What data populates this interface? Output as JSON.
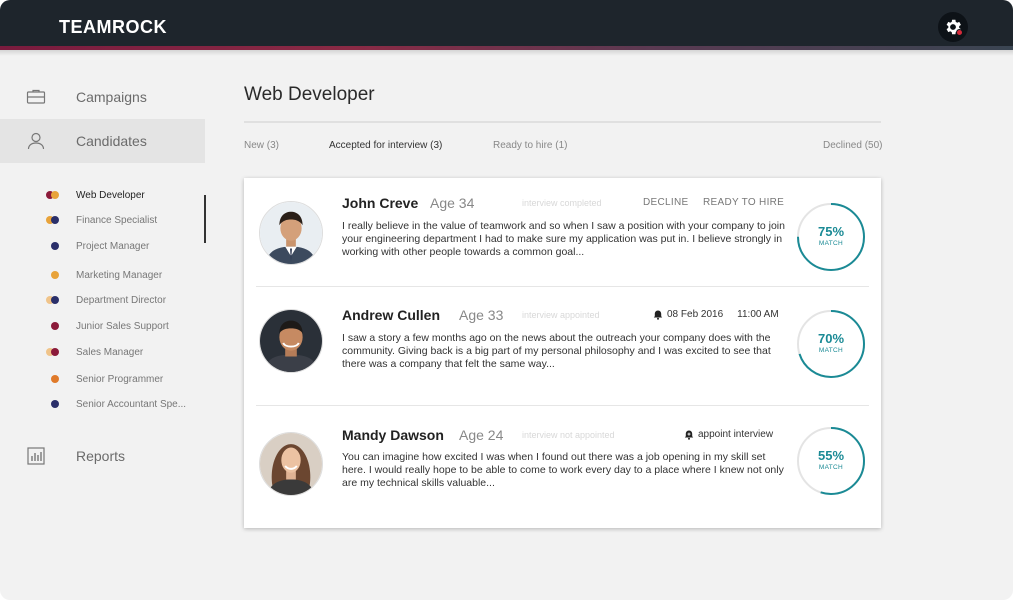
{
  "brand": {
    "logo_text": "TEAMROCK",
    "accent_colors": [
      "#7a1b3e",
      "#3a4552"
    ],
    "match_color": "#1a8a95"
  },
  "header": {
    "settings_icon": "gear-icon",
    "notification_color": "#d62a3a"
  },
  "sidebar": {
    "items": [
      {
        "label": "Campaigns",
        "icon": "briefcase-icon"
      },
      {
        "label": "Candidates",
        "icon": "user-icon"
      },
      {
        "label": "Reports",
        "icon": "bar-chart-icon"
      }
    ],
    "positions": [
      {
        "label": "Web Developer",
        "colors": [
          "#8b1a3a",
          "#e8a33a"
        ]
      },
      {
        "label": "Finance Specialist",
        "colors": [
          "#e8a33a",
          "#2a2f6a"
        ]
      },
      {
        "label": "Project Manager",
        "colors": [
          "#2a2f6a"
        ]
      },
      {
        "label": "Marketing Manager",
        "colors": [
          "#e8a33a"
        ]
      },
      {
        "label": "Department Director",
        "colors": [
          "#f0c48a",
          "#2a2f6a"
        ]
      },
      {
        "label": "Junior Sales Support",
        "colors": [
          "#8b1a3a"
        ]
      },
      {
        "label": "Sales Manager",
        "colors": [
          "#f0c48a",
          "#8b1a3a"
        ]
      },
      {
        "label": "Senior Programmer",
        "colors": [
          "#e07a2a"
        ]
      },
      {
        "label": "Senior Accountant Spe...",
        "colors": [
          "#2a2f6a"
        ]
      }
    ]
  },
  "main": {
    "title": "Web Developer",
    "tabs": [
      {
        "label": "New (3)"
      },
      {
        "label": "Accepted for interview (3)"
      },
      {
        "label": "Ready to hire (1)"
      },
      {
        "label": "Declined (50)"
      }
    ],
    "candidates": [
      {
        "name": "John Creve",
        "age": "Age 34",
        "status": "interview completed",
        "actions": [
          "DECLINE",
          "READY TO HIRE"
        ],
        "text": "I really believe in the value of teamwork and so when I saw a position with your company to join your engineering department I had to make sure my application was put in.  I believe strongly in working with other people towards a common goal...",
        "match_pct": "75%",
        "match_value": 75,
        "match_label": "MATCH"
      },
      {
        "name": "Andrew Cullen",
        "age": "Age 33",
        "status": "interview appointed",
        "interview_date": "08 Feb 2016",
        "interview_time": "11:00 AM",
        "text": "I saw a story a few months ago on the news about the outreach your company does with the community.  Giving back is a big part of my personal philosophy and I was excited to see that there was a company that felt the same way...",
        "match_pct": "70%",
        "match_value": 70,
        "match_label": "MATCH"
      },
      {
        "name": "Mandy Dawson",
        "age": "Age 24",
        "status": "interview not appointed",
        "appoint_label": "appoint interview",
        "text": "You can imagine how excited I was when I found out there was a job opening in my skill set here.  I would really hope to be able to come to work every day to a place where I knew not only are my technical skills valuable...",
        "match_pct": "55%",
        "match_value": 55,
        "match_label": "MATCH"
      }
    ]
  }
}
